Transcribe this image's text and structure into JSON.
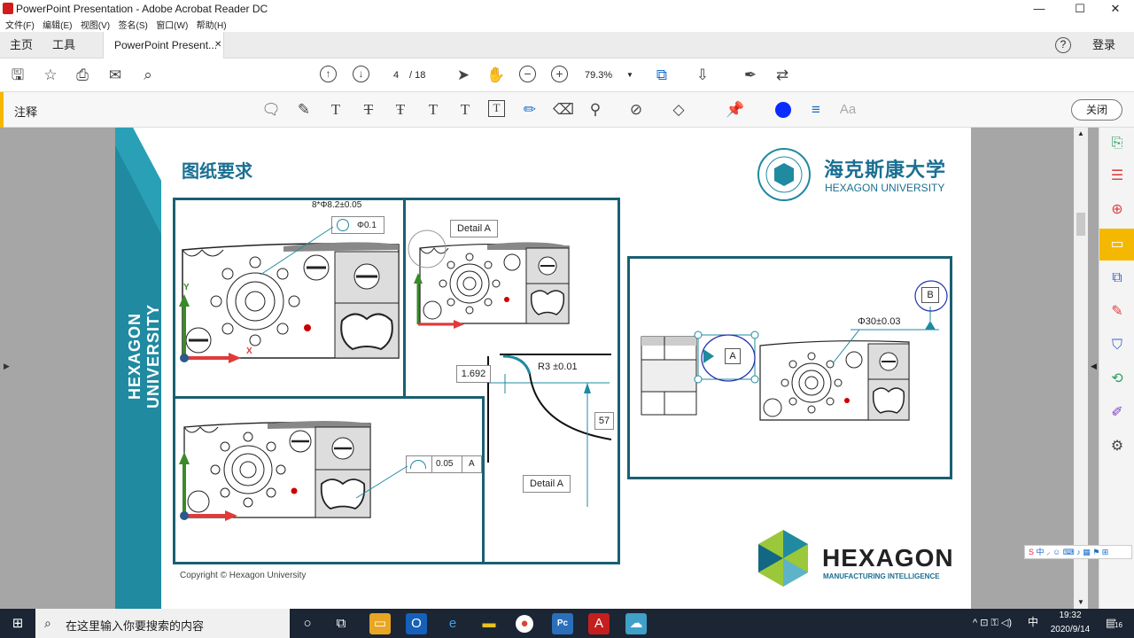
{
  "window": {
    "title": "PowerPoint Presentation - Adobe Acrobat Reader DC",
    "min": "—",
    "max": "☐",
    "close": "✕"
  },
  "menu": [
    "文件(F)",
    "编辑(E)",
    "视图(V)",
    "签名(S)",
    "窗口(W)",
    "帮助(H)"
  ],
  "tabs": {
    "home": "主页",
    "tools": "工具",
    "doc": "PowerPoint Present...",
    "doc_close": "✕",
    "login": "登录",
    "help": "?"
  },
  "toolbar": {
    "page_current": "4",
    "page_total": "/ 18",
    "zoom": "79.3%"
  },
  "comment": {
    "title": "注释",
    "close": "关闭",
    "accent_color": "#f5b800"
  },
  "slide": {
    "side_text": "HEXAGON UNIVERSITY",
    "heading": "图纸要求",
    "logo_cn": "海克斯康大学",
    "logo_en": "HEXAGON UNIVERSITY",
    "brand": "HEXAGON",
    "brand_sub": "MANUFACTURING INTELLIGENCE",
    "copyright": "Copyright © Hexagon University",
    "hole_spec": "8*Φ8.2±0.05",
    "pos_tol": "Φ0.1",
    "detail_a": "Detail A",
    "detail_a2": "Detail A",
    "dim_1692": "1.692",
    "radius": "R3 ±0.01",
    "dim_57": "57",
    "profile_tol": "0.05",
    "datum_a": "A",
    "datum_a2": "A",
    "datum_b": "B",
    "dia30": "Φ30±0.03",
    "axis_y": "Y",
    "axis_x": "X"
  },
  "taskbar": {
    "search_placeholder": "在这里输入你要搜索的内容",
    "time": "19:32",
    "date": "2020/9/14",
    "notif": "16"
  },
  "colors": {
    "frame": "#1a5f72",
    "accent_teal": "#1f8aa0",
    "heading": "#1a6f92"
  }
}
